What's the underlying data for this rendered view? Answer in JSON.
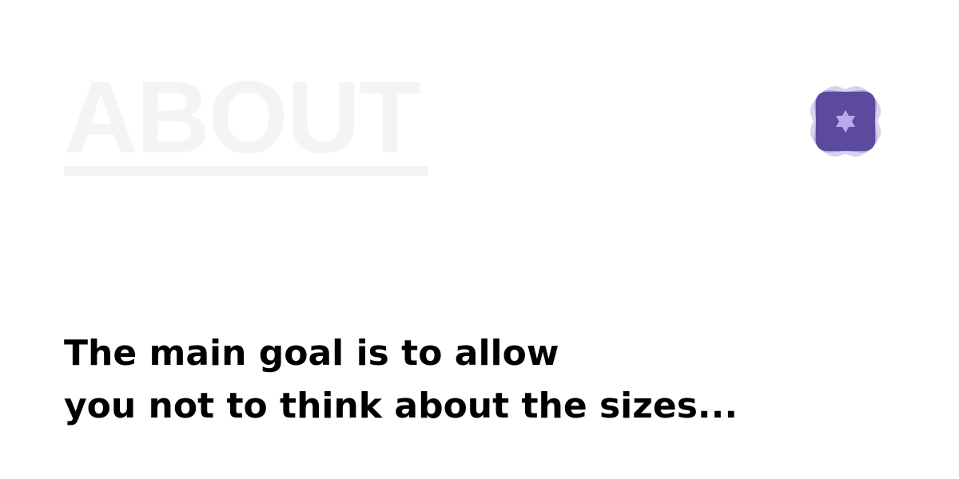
{
  "heading": "ABOUT",
  "logo": {
    "icon": "star-of-david-icon",
    "accent_color": "#5c4a9e",
    "glow_color": "#8f7fd0",
    "star_color": "#b9a9ef"
  },
  "tagline": {
    "line1": "The main goal is to allow",
    "line2": "you not to think about the sizes..."
  }
}
